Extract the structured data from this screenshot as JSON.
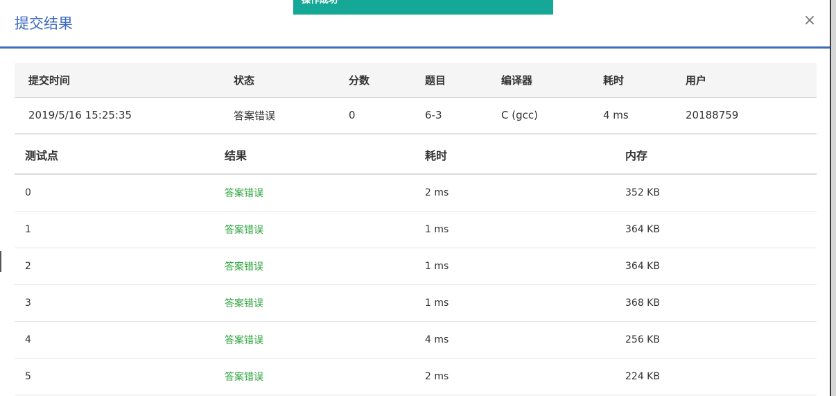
{
  "dialog": {
    "title": "提交结果",
    "close_label": "×"
  },
  "toast": {
    "text": "操作成功",
    "color": "#16a896"
  },
  "summary": {
    "headers": [
      "提交时间",
      "状态",
      "分数",
      "题目",
      "编译器",
      "耗时",
      "用户"
    ],
    "row": {
      "time": "2019/5/16 15:25:35",
      "status": "答案错误",
      "score": "0",
      "problem": "6-3",
      "compiler": "C (gcc)",
      "elapsed": "4 ms",
      "user": "20188759"
    }
  },
  "cases": {
    "headers": [
      "测试点",
      "结果",
      "耗时",
      "内存"
    ],
    "rows": [
      {
        "id": "0",
        "result": "答案错误",
        "time": "2 ms",
        "memory": "352 KB"
      },
      {
        "id": "1",
        "result": "答案错误",
        "time": "1 ms",
        "memory": "364 KB"
      },
      {
        "id": "2",
        "result": "答案错误",
        "time": "1 ms",
        "memory": "364 KB"
      },
      {
        "id": "3",
        "result": "答案错误",
        "time": "1 ms",
        "memory": "368 KB"
      },
      {
        "id": "4",
        "result": "答案错误",
        "time": "4 ms",
        "memory": "256 KB"
      },
      {
        "id": "5",
        "result": "答案错误",
        "time": "2 ms",
        "memory": "224 KB"
      }
    ]
  },
  "colors": {
    "accent": "#3d6bbf",
    "status_wrong": "#2ca43c",
    "link": "#1f5fa7"
  }
}
